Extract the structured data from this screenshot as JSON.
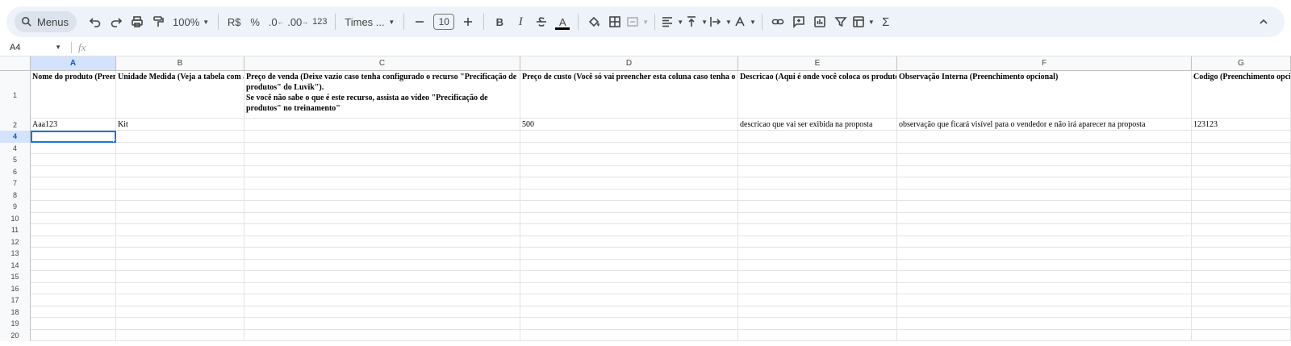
{
  "toolbar": {
    "menus_label": "Menus",
    "zoom": "100%",
    "currency": "R$",
    "percent": "%",
    "decrease_decimal": ".0",
    "increase_decimal": ".00",
    "number_format": "123",
    "font_name": "Times ...",
    "font_size": "10",
    "bold": "B",
    "italic": "I",
    "text_color": "A",
    "sum": "Σ"
  },
  "formula_bar": {
    "name_box": "A4",
    "fx": "fx",
    "content": ""
  },
  "columns": [
    "A",
    "B",
    "C",
    "D",
    "E",
    "F",
    "G"
  ],
  "rows": [
    "1",
    "2",
    "4",
    "4",
    "5",
    "6",
    "7",
    "8",
    "9",
    "10",
    "11",
    "12",
    "13",
    "14",
    "15",
    "16",
    "17",
    "18",
    "19",
    "20"
  ],
  "sheet": {
    "header_row": {
      "a": "Nome do produto (Preenchimento obrigatório)",
      "b": "Unidade Medida (Veja a tabela com as unidades)",
      "c": "Preço de venda (Deixe vazio caso tenha configurado o recurso \"Precificação de produtos\" do Luvik\").\nSe você não sabe o que é este recurso, assista ao vídeo \"Precificação de produtos\" no treinamento\"",
      "d": "Preço de custo (Você só vai preencher  esta coluna caso tenha o recurso ativo)",
      "e": "Descricao (Aqui é onde você coloca os produtos)",
      "f": "Observação Interna (Preenchimento opcional)",
      "g": "Codigo (Preenchimento opcional)"
    },
    "data_row": {
      "a": "Aaa123",
      "b": "Kit",
      "c": "",
      "d": "500",
      "e": "descricao que vai ser exibida na proposta",
      "f": "observação que ficará visível para o vendedor e não irá aparecer na proposta",
      "g": "123123"
    }
  },
  "selected_cell": "A4",
  "colors": {
    "toolbar_bg": "#eef2f9",
    "selection": "#1a73e8",
    "header_selected_bg": "#d3e3fd"
  }
}
